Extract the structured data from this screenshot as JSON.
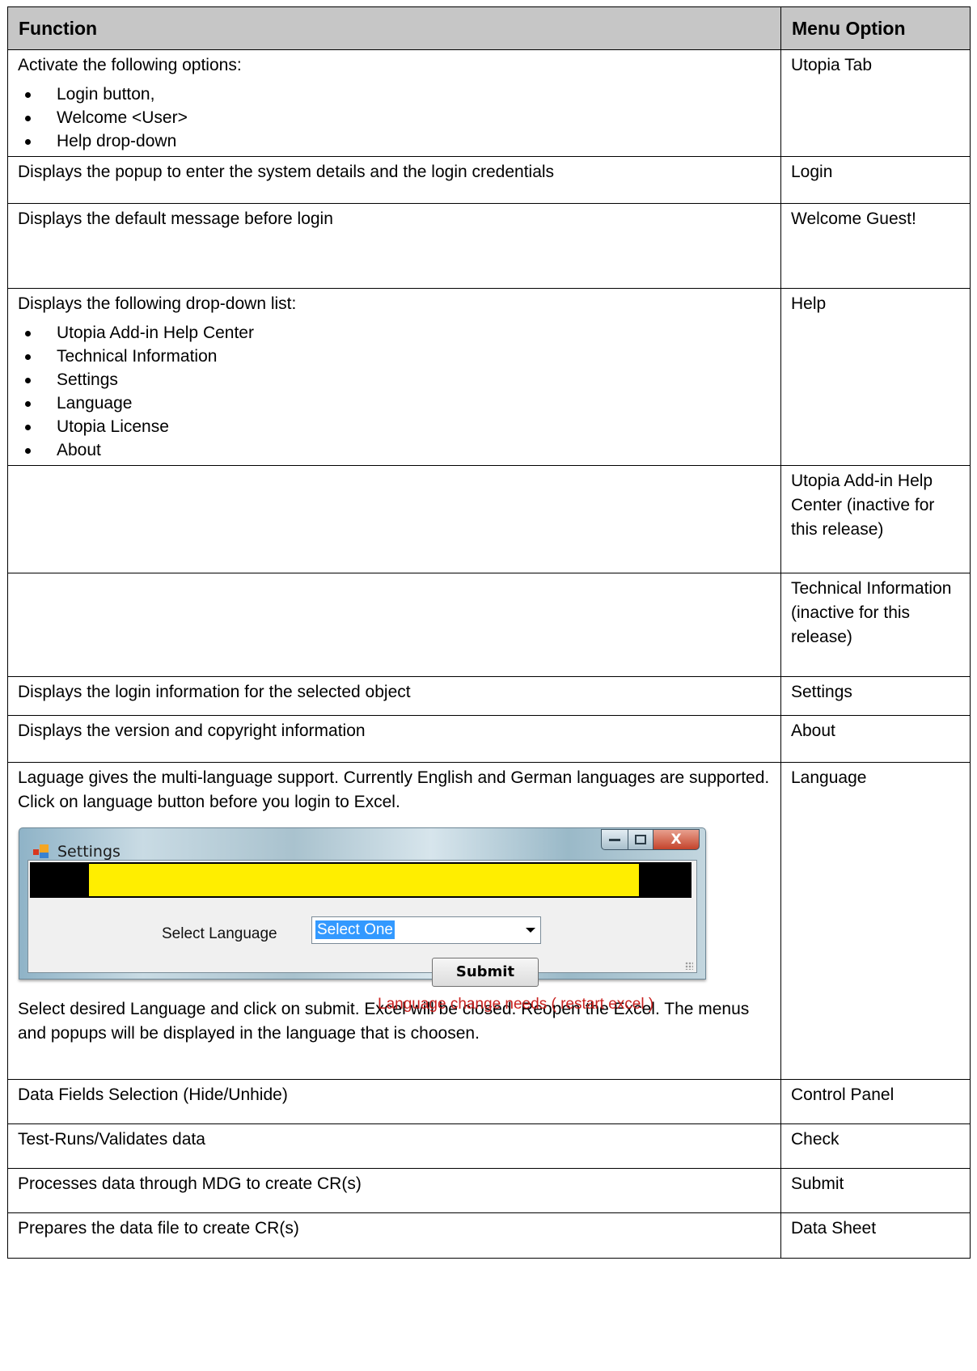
{
  "table": {
    "headers": {
      "function": "Function",
      "menu_option": "Menu Option"
    },
    "rows": [
      {
        "function_text": "Activate the following options:",
        "bullets": [
          "Login button,",
          "Welcome <User>",
          "Help drop-down"
        ],
        "menu_option": "Utopia Tab"
      },
      {
        "function_text": "Displays the popup to enter the system details and the login credentials",
        "menu_option": "Login"
      },
      {
        "function_text": "Displays the default message before login",
        "menu_option": "Welcome Guest!"
      },
      {
        "function_text": "Displays the following drop-down list:",
        "bullets": [
          "Utopia Add-in Help Center",
          "Technical Information",
          "Settings",
          "Language",
          "Utopia License",
          "About"
        ],
        "menu_option": "Help"
      },
      {
        "function_text": "",
        "menu_option": "Utopia Add-in Help Center (inactive for this release)"
      },
      {
        "function_text": "",
        "menu_option": "Technical Information (inactive for this release)"
      },
      {
        "function_text": "Displays the login information for the selected object",
        "menu_option": "Settings"
      },
      {
        "function_text": "Displays the version and copyright information",
        "menu_option": "About"
      },
      {
        "function_text": "Laguage gives the multi-language support. Currently English and German languages are supported. Click on language button before you login to Excel.",
        "function_text_after": "Select desired Language and click on submit. Excel will be closed. Reopen the Excel. The menus and popups will be displayed in the language that is choosen.",
        "menu_option": "Language"
      },
      {
        "function_text": "Data Fields Selection (Hide/Unhide)",
        "menu_option": "Control Panel"
      },
      {
        "function_text": "Test-Runs/Validates data",
        "menu_option": "Check"
      },
      {
        "function_text": "Processes data through MDG to create CR(s)",
        "menu_option": "Submit"
      },
      {
        "function_text": "Prepares the data file to create CR(s)",
        "menu_option": "Data Sheet"
      }
    ]
  },
  "settings_window": {
    "title": "Settings",
    "title_icon": "window-app-icon",
    "controls": {
      "minimize": "minimize-icon",
      "maximize": "maximize-icon",
      "close": "X"
    },
    "select_label": "Select Language",
    "select_value": "Select One",
    "submit_label": "Submit",
    "restart_message": "Language change needs ( restart excel )",
    "colors": {
      "banner_yellow": "#ffee00",
      "banner_black": "#000000",
      "selection_blue": "#3399ff",
      "warning_red": "#c8201e"
    }
  }
}
